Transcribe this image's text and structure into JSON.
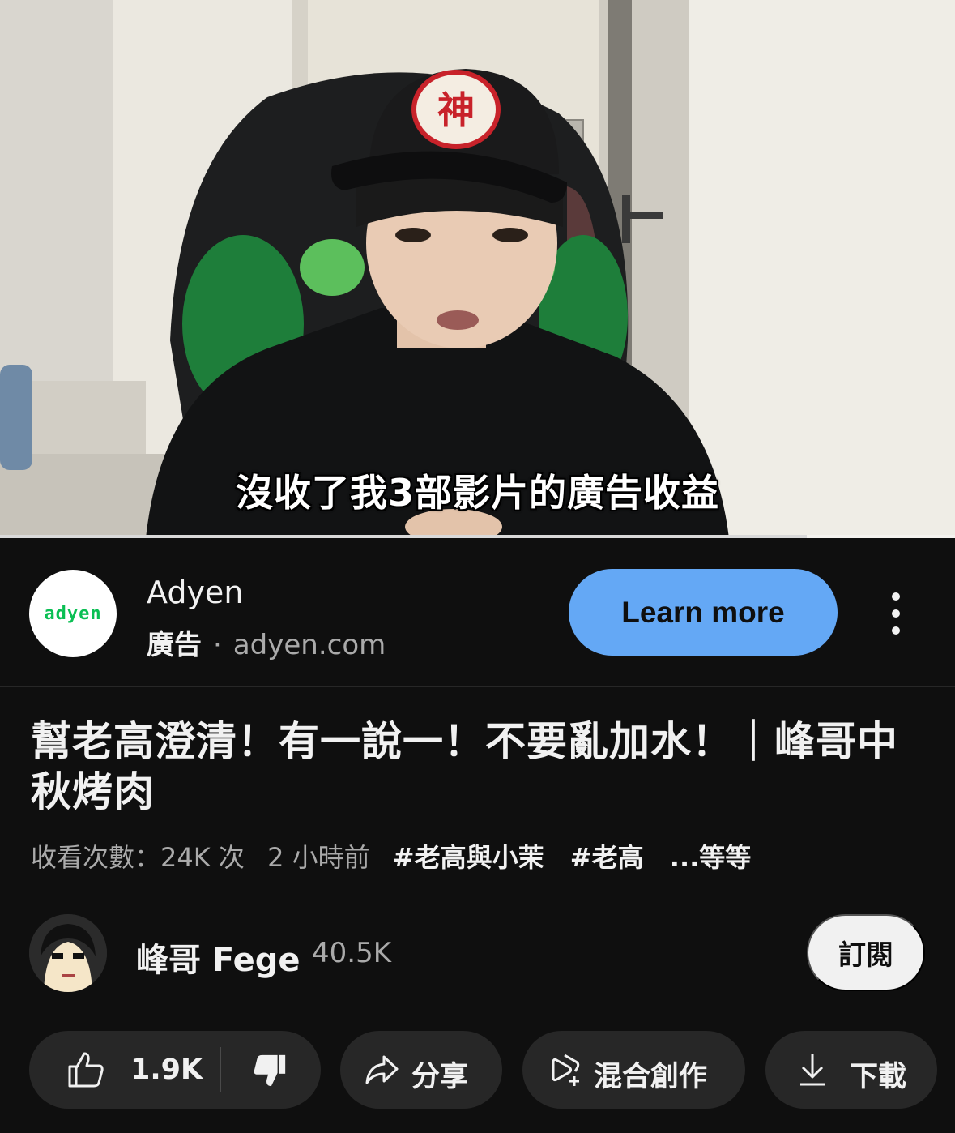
{
  "video": {
    "subtitle": "沒收了我3部影片的廣告收益",
    "progress": 0.845
  },
  "ad": {
    "logo_text": "adyen",
    "name": "Adyen",
    "label": "廣告",
    "separator": "·",
    "domain": "adyen.com",
    "cta": "Learn more",
    "menu_icon": "more-vert-icon",
    "accent_color": "#64a8f5"
  },
  "video_info": {
    "title": "幫老高澄清！有一說一！不要亂加水！｜峰哥中秋烤肉",
    "views": "收看次數：24K 次",
    "age": "2 小時前",
    "hashtags": [
      "#老高與小茉",
      "#老高"
    ],
    "more": "...等等"
  },
  "channel": {
    "name": "峰哥 Fege",
    "subscribers": "40.5K",
    "subscribe_label": "訂閱"
  },
  "actions": {
    "like_count": "1.9K",
    "share_label": "分享",
    "remix_label": "混合創作",
    "download_label": "下載"
  }
}
